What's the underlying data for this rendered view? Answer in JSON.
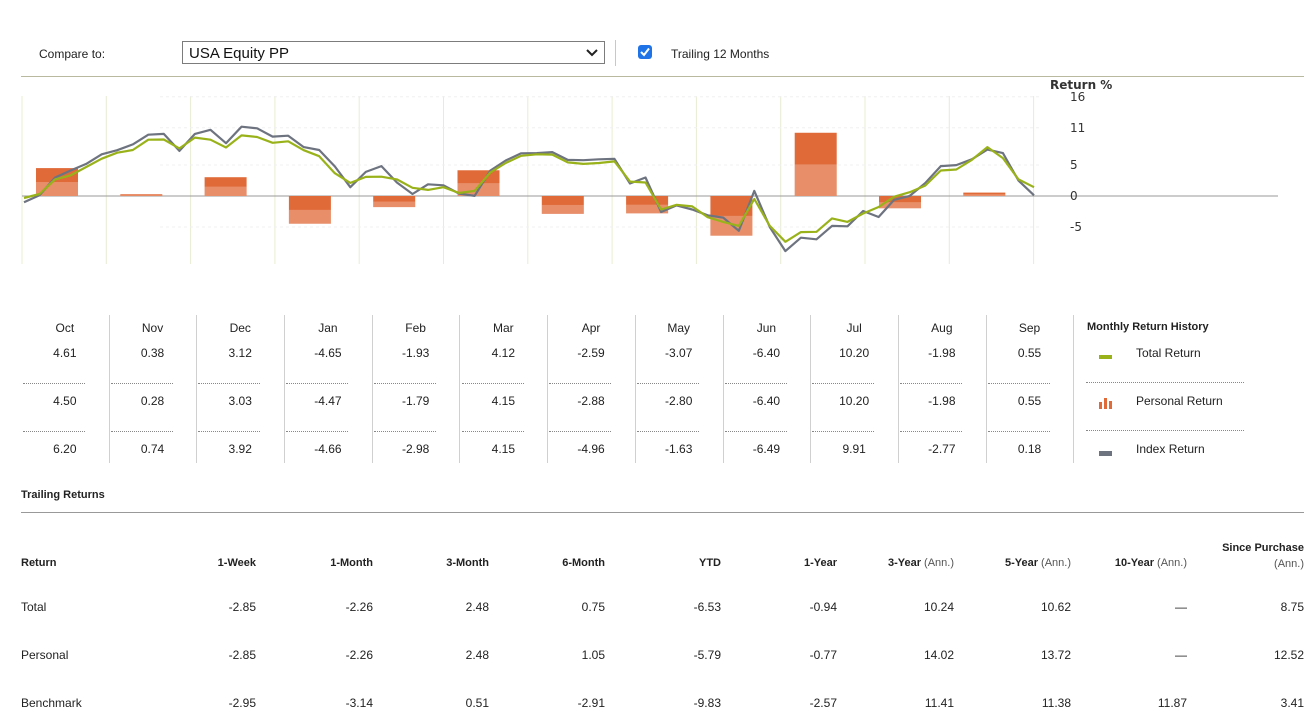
{
  "controls": {
    "compare_label": "Compare to:",
    "compare_value": "USA Equity PP",
    "trailing_checked": true,
    "trailing_label": "Trailing 12 Months"
  },
  "colors": {
    "total": "#9ab21a",
    "personal": "#e06a38",
    "index": "#6e7380"
  },
  "chart_data": {
    "type": "bar",
    "y_axis_title": "Return %",
    "y_ticks": [
      16,
      11,
      5,
      0,
      -5
    ],
    "ylim": [
      -11,
      16
    ],
    "categories": [
      "Oct",
      "Nov",
      "Dec",
      "Jan",
      "Feb",
      "Mar",
      "Apr",
      "May",
      "Jun",
      "Jul",
      "Aug",
      "Sep"
    ],
    "series": [
      {
        "name": "Total Return",
        "values": [
          4.61,
          0.38,
          3.12,
          -4.65,
          -1.93,
          4.12,
          -2.59,
          -3.07,
          -6.4,
          10.2,
          -1.98,
          0.55
        ]
      },
      {
        "name": "Personal Return",
        "values": [
          4.5,
          0.28,
          3.03,
          -4.47,
          -1.79,
          4.15,
          -2.88,
          -2.8,
          -6.4,
          10.2,
          -1.98,
          0.55
        ]
      },
      {
        "name": "Index Return",
        "values": [
          6.2,
          0.74,
          3.92,
          -4.66,
          -2.98,
          4.15,
          -4.96,
          -1.63,
          -6.49,
          9.91,
          -2.77,
          0.18
        ]
      }
    ],
    "cumulative_lines": {
      "total_return": [
        -0.5,
        0.5,
        2.5,
        3.5,
        4.5,
        6.2,
        6.8,
        7.6,
        8.9,
        9.3,
        7.5,
        9.6,
        8.9,
        8.0,
        9.6,
        9.7,
        8.4,
        9.0,
        7.2,
        6.6,
        3.5,
        2.3,
        2.9,
        3.3,
        2.5,
        1.5,
        0.8,
        1.6,
        0.3,
        1.0,
        3.6,
        5.5,
        6.3,
        6.9,
        6.5,
        5.6,
        5.0,
        5.5,
        5.4,
        2.5,
        2.0,
        -2.0,
        -1.6,
        -1.5,
        -3.6,
        -4.0,
        -5.0,
        -0.3,
        -5.0,
        -7.2,
        -6.0,
        -5.6,
        -3.8,
        -4.0,
        -3.0,
        -1.6,
        -0.3,
        0.8,
        1.5,
        4.3,
        4.1,
        6.0,
        7.7,
        6.3,
        2.5,
        1.6
      ],
      "index_return": [
        -1.2,
        0.3,
        2.8,
        4.3,
        5.0,
        6.9,
        7.2,
        8.5,
        9.7,
        10.2,
        7.1,
        10.2,
        10.5,
        8.7,
        11.0,
        11.1,
        9.4,
        9.9,
        7.7,
        7.6,
        4.6,
        1.6,
        3.7,
        5.0,
        2.0,
        0.5,
        1.7,
        1.9,
        0.2,
        0.2,
        3.9,
        5.9,
        6.7,
        7.1,
        6.9,
        6.0,
        5.6,
        6.1,
        5.8,
        2.2,
        2.8,
        -2.4,
        -1.7,
        -2.0,
        -3.3,
        -3.3,
        -5.8,
        1.0,
        -5.2,
        -8.7,
        -6.9,
        -6.8,
        -5.0,
        -4.7,
        -2.6,
        -3.2,
        -0.8,
        0.2,
        1.9,
        5.0,
        4.8,
        6.1,
        7.3,
        7.1,
        2.3,
        0.3
      ]
    }
  },
  "monthly_table": {
    "months": [
      {
        "name": "Oct",
        "total": "4.61",
        "personal": "4.50",
        "index": "6.20"
      },
      {
        "name": "Nov",
        "total": "0.38",
        "personal": "0.28",
        "index": "0.74"
      },
      {
        "name": "Dec",
        "total": "3.12",
        "personal": "3.03",
        "index": "3.92"
      },
      {
        "name": "Jan",
        "total": "-4.65",
        "personal": "-4.47",
        "index": "-4.66"
      },
      {
        "name": "Feb",
        "total": "-1.93",
        "personal": "-1.79",
        "index": "-2.98"
      },
      {
        "name": "Mar",
        "total": "4.12",
        "personal": "4.15",
        "index": "4.15"
      },
      {
        "name": "Apr",
        "total": "-2.59",
        "personal": "-2.88",
        "index": "-4.96"
      },
      {
        "name": "May",
        "total": "-3.07",
        "personal": "-2.80",
        "index": "-1.63"
      },
      {
        "name": "Jun",
        "total": "-6.40",
        "personal": "-6.40",
        "index": "-6.49"
      },
      {
        "name": "Jul",
        "total": "10.20",
        "personal": "10.20",
        "index": "9.91"
      },
      {
        "name": "Aug",
        "total": "-1.98",
        "personal": "-1.98",
        "index": "-2.77"
      },
      {
        "name": "Sep",
        "total": "0.55",
        "personal": "0.55",
        "index": "0.18"
      }
    ],
    "legend_title": "Monthly Return History",
    "legend": [
      "Total Return",
      "Personal Return",
      "Index Return"
    ]
  },
  "trailing": {
    "title": "Trailing Returns",
    "headers": [
      {
        "label": "Return",
        "ann": ""
      },
      {
        "label": "1-Week",
        "ann": ""
      },
      {
        "label": "1-Month",
        "ann": ""
      },
      {
        "label": "3-Month",
        "ann": ""
      },
      {
        "label": "6-Month",
        "ann": ""
      },
      {
        "label": "YTD",
        "ann": ""
      },
      {
        "label": "1-Year",
        "ann": ""
      },
      {
        "label": "3-Year",
        "ann": "(Ann.)"
      },
      {
        "label": "5-Year",
        "ann": "(Ann.)"
      },
      {
        "label": "10-Year",
        "ann": "(Ann.)"
      },
      {
        "label": "Since Purchase",
        "ann": "(Ann.)"
      }
    ],
    "rows": [
      [
        "Total",
        "-2.85",
        "-2.26",
        "2.48",
        "0.75",
        "-6.53",
        "-0.94",
        "10.24",
        "10.62",
        "—",
        "8.75"
      ],
      [
        "Personal",
        "-2.85",
        "-2.26",
        "2.48",
        "1.05",
        "-5.79",
        "-0.77",
        "14.02",
        "13.72",
        "—",
        "12.52"
      ],
      [
        "Benchmark",
        "-2.95",
        "-3.14",
        "0.51",
        "-2.91",
        "-9.83",
        "-2.57",
        "11.41",
        "11.38",
        "11.87",
        "3.41"
      ]
    ]
  }
}
